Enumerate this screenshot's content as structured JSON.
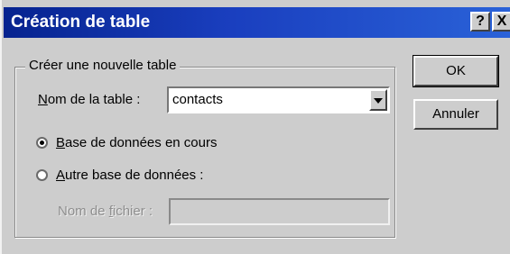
{
  "window": {
    "title": "Création de table",
    "help_label": "?",
    "close_label": "X"
  },
  "group": {
    "legend": "Créer une nouvelle table"
  },
  "table_name": {
    "label_accel": "N",
    "label_rest": "om de la table :",
    "value": "contacts"
  },
  "options": [
    {
      "accel": "B",
      "rest": "ase de données en cours",
      "selected": true
    },
    {
      "accel": "A",
      "rest": "utre base de données :",
      "selected": false
    }
  ],
  "file": {
    "label_pre": "Nom de ",
    "label_accel": "f",
    "label_rest": "ichier :",
    "value": ""
  },
  "buttons": {
    "ok": "OK",
    "cancel": "Annuler"
  }
}
